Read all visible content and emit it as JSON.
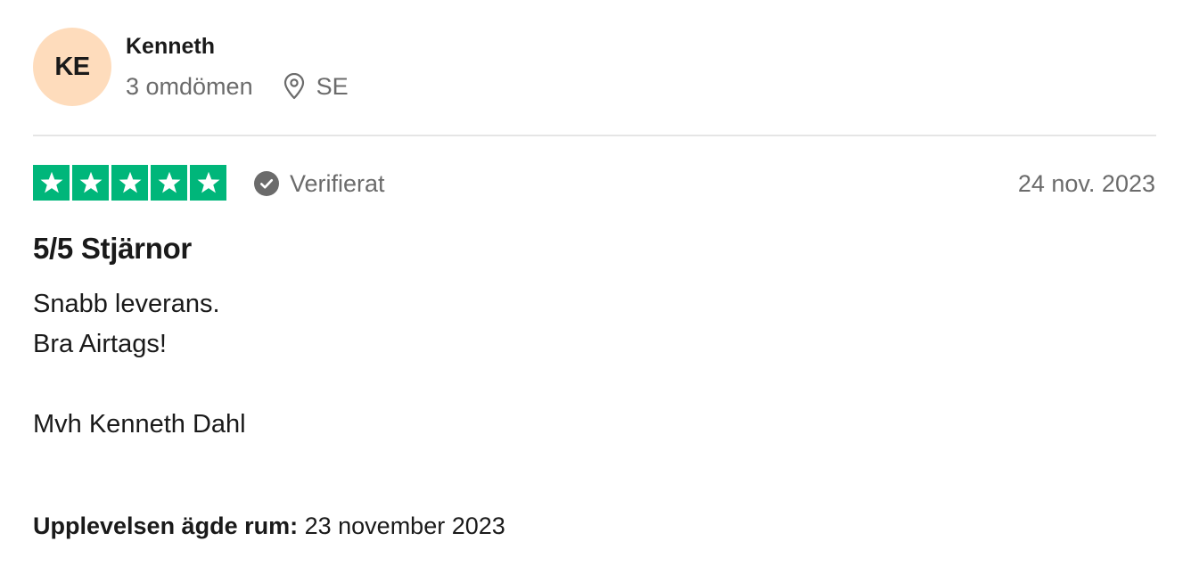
{
  "reviewer": {
    "initials": "KE",
    "name": "Kenneth",
    "review_count": "3 omdömen",
    "country": "SE",
    "avatar_color": "#fedcbc"
  },
  "rating": {
    "stars": 5,
    "max_stars": 5,
    "star_color": "#00b67a",
    "verified_label": "Verifierat",
    "date": "24 nov. 2023"
  },
  "review": {
    "title": "5/5 Stjärnor",
    "body_lines": [
      "Snabb leverans.",
      "Bra Airtags!",
      "",
      "Mvh Kenneth Dahl"
    ],
    "experience_label": "Upplevelsen ägde rum:",
    "experience_date": "23 november 2023"
  },
  "icons": {
    "location": "location-pin-icon",
    "verified": "check-circle-icon",
    "star": "star-icon"
  }
}
